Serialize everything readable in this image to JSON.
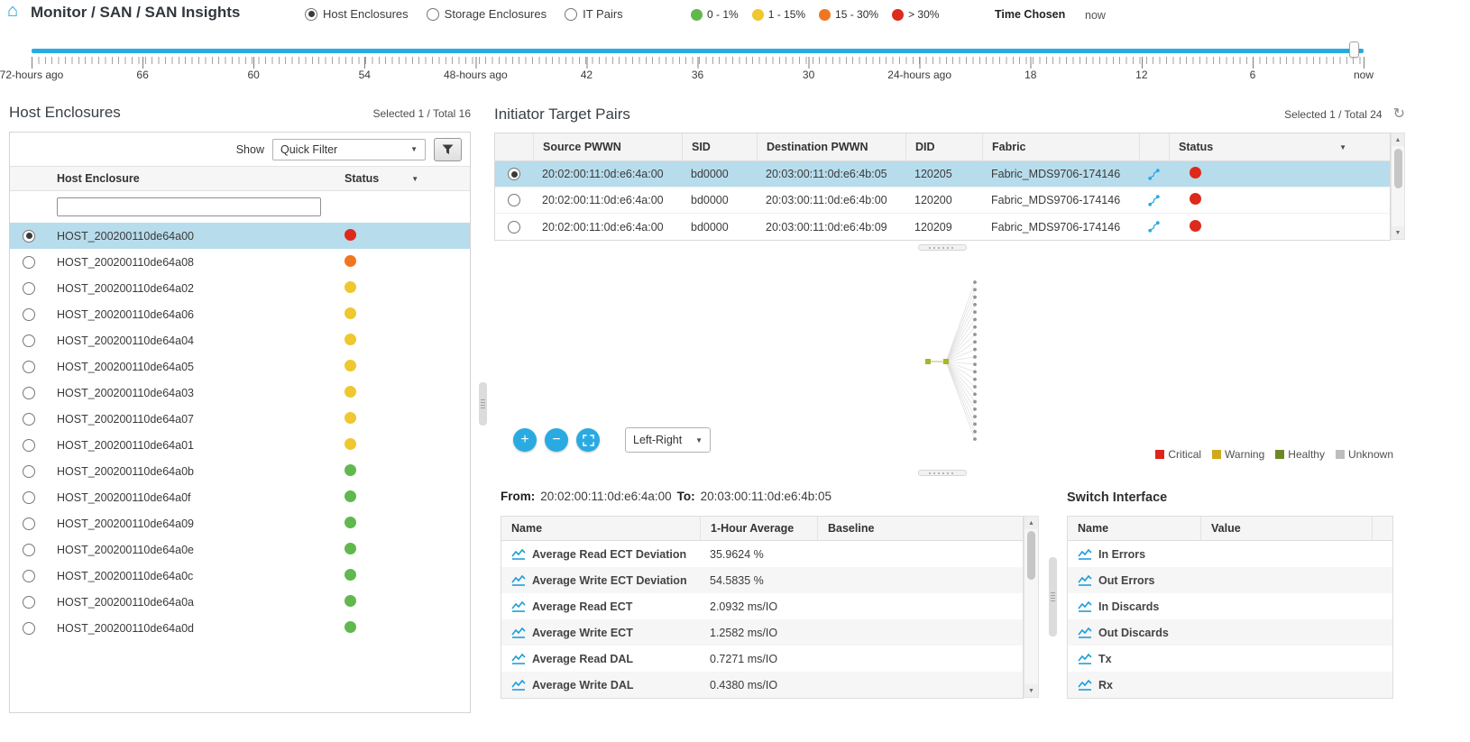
{
  "status_colors": {
    "red": "#dd2a1b",
    "orange": "#f07622",
    "yellow": "#efc72f",
    "green": "#61b84e"
  },
  "icons": {
    "home": "⌂",
    "caret_down": "▼",
    "up_arrow": "▲",
    "down_arrow": "▼",
    "refresh": "↻",
    "zoom_in": "+",
    "zoom_out": "−"
  },
  "header": {
    "breadcrumb": "Monitor / SAN / SAN Insights",
    "view_options": [
      {
        "label": "Host Enclosures",
        "selected": true
      },
      {
        "label": "Storage Enclosures",
        "selected": false
      },
      {
        "label": "IT Pairs",
        "selected": false
      }
    ],
    "usage_legend": [
      {
        "label": "0 - 1%",
        "color": "#61b84e"
      },
      {
        "label": "1 - 15%",
        "color": "#efc72f"
      },
      {
        "label": "15 - 30%",
        "color": "#f07622"
      },
      {
        "label": "> 30%",
        "color": "#dd2a1b"
      }
    ],
    "time_chosen_label": "Time Chosen",
    "time_chosen_value": "now"
  },
  "timeline": {
    "labels": [
      "72-hours ago",
      "66",
      "60",
      "54",
      "48-hours ago",
      "42",
      "36",
      "30",
      "24-hours ago",
      "18",
      "12",
      "6",
      "now"
    ]
  },
  "host_enclosures": {
    "title": "Host Enclosures",
    "selection_summary": "Selected 1 / Total 16",
    "show_label": "Show",
    "filter_dropdown": "Quick Filter",
    "filter_value": "",
    "columns": [
      "Host Enclosure",
      "Status"
    ],
    "rows": [
      {
        "name": "HOST_200200110de64a00",
        "status": "red",
        "selected": true
      },
      {
        "name": "HOST_200200110de64a08",
        "status": "orange"
      },
      {
        "name": "HOST_200200110de64a02",
        "status": "yellow"
      },
      {
        "name": "HOST_200200110de64a06",
        "status": "yellow"
      },
      {
        "name": "HOST_200200110de64a04",
        "status": "yellow"
      },
      {
        "name": "HOST_200200110de64a05",
        "status": "yellow"
      },
      {
        "name": "HOST_200200110de64a03",
        "status": "yellow"
      },
      {
        "name": "HOST_200200110de64a07",
        "status": "yellow"
      },
      {
        "name": "HOST_200200110de64a01",
        "status": "yellow"
      },
      {
        "name": "HOST_200200110de64a0b",
        "status": "green"
      },
      {
        "name": "HOST_200200110de64a0f",
        "status": "green"
      },
      {
        "name": "HOST_200200110de64a09",
        "status": "green"
      },
      {
        "name": "HOST_200200110de64a0e",
        "status": "green"
      },
      {
        "name": "HOST_200200110de64a0c",
        "status": "green"
      },
      {
        "name": "HOST_200200110de64a0a",
        "status": "green"
      },
      {
        "name": "HOST_200200110de64a0d",
        "status": "green"
      }
    ]
  },
  "it_pairs": {
    "title": "Initiator Target Pairs",
    "selection_summary": "Selected 1 / Total 24",
    "columns": [
      "Source PWWN",
      "SID",
      "Destination PWWN",
      "DID",
      "Fabric",
      "Status"
    ],
    "rows": [
      {
        "source": "20:02:00:11:0d:e6:4a:00",
        "sid": "bd0000",
        "dest": "20:03:00:11:0d:e6:4b:05",
        "did": "120205",
        "fabric": "Fabric_MDS9706-174146",
        "status": "red",
        "selected": true
      },
      {
        "source": "20:02:00:11:0d:e6:4a:00",
        "sid": "bd0000",
        "dest": "20:03:00:11:0d:e6:4b:00",
        "did": "120200",
        "fabric": "Fabric_MDS9706-174146",
        "status": "red"
      },
      {
        "source": "20:02:00:11:0d:e6:4a:00",
        "sid": "bd0000",
        "dest": "20:03:00:11:0d:e6:4b:09",
        "did": "120209",
        "fabric": "Fabric_MDS9706-174146",
        "status": "red"
      }
    ]
  },
  "topology": {
    "layout_dropdown": "Left-Right",
    "node_count": 22,
    "legend": [
      {
        "label": "Critical",
        "color": "#e2231a"
      },
      {
        "label": "Warning",
        "color": "#cfa91c"
      },
      {
        "label": "Healthy",
        "color": "#6d8a22"
      },
      {
        "label": "Unknown",
        "color": "#bdbdbd"
      }
    ]
  },
  "metrics": {
    "from_label": "From:",
    "from_value": "20:02:00:11:0d:e6:4a:00",
    "to_label": "To:",
    "to_value": "20:03:00:11:0d:e6:4b:05",
    "columns": [
      "Name",
      "1-Hour Average",
      "Baseline"
    ],
    "rows": [
      {
        "name": "Average Read ECT Deviation",
        "avg": "35.9624 %",
        "baseline": ""
      },
      {
        "name": "Average Write ECT Deviation",
        "avg": "54.5835 %",
        "baseline": ""
      },
      {
        "name": "Average Read ECT",
        "avg": "2.0932 ms/IO",
        "baseline": ""
      },
      {
        "name": "Average Write ECT",
        "avg": "1.2582 ms/IO",
        "baseline": ""
      },
      {
        "name": "Average Read DAL",
        "avg": "0.7271 ms/IO",
        "baseline": ""
      },
      {
        "name": "Average Write DAL",
        "avg": "0.4380 ms/IO",
        "baseline": ""
      }
    ]
  },
  "switch_interface": {
    "title": "Switch Interface",
    "columns": [
      "Name",
      "Value"
    ],
    "rows": [
      {
        "name": "In Errors",
        "value": ""
      },
      {
        "name": "Out Errors",
        "value": ""
      },
      {
        "name": "In Discards",
        "value": ""
      },
      {
        "name": "Out Discards",
        "value": ""
      },
      {
        "name": "Tx",
        "value": ""
      },
      {
        "name": "Rx",
        "value": ""
      }
    ]
  }
}
